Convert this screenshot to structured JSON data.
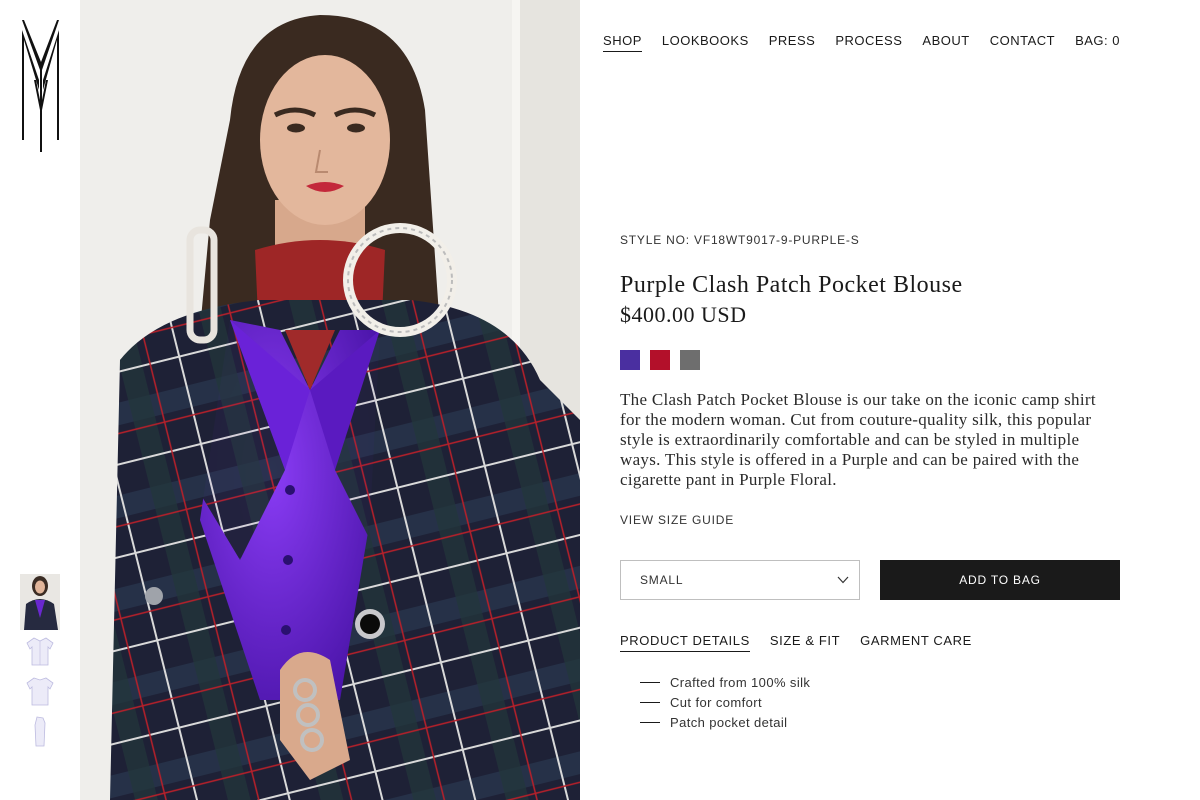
{
  "brand": {
    "logo_icon": "vm-monogram-icon"
  },
  "nav": {
    "items": [
      {
        "label": "SHOP",
        "active": true
      },
      {
        "label": "LOOKBOOKS"
      },
      {
        "label": "PRESS"
      },
      {
        "label": "PROCESS"
      },
      {
        "label": "ABOUT"
      },
      {
        "label": "CONTACT"
      },
      {
        "label": "BAG: 0"
      }
    ]
  },
  "product": {
    "style_no": "STYLE NO: VF18WT9017-9-PURPLE-S",
    "title": "Purple Clash Patch Pocket Blouse",
    "price": "$400.00 USD",
    "swatches": [
      {
        "name": "purple",
        "color": "#4a2fa0"
      },
      {
        "name": "red",
        "color": "#b3102a"
      },
      {
        "name": "silver",
        "color": "#6e6e6e"
      }
    ],
    "description": "The Clash Patch Pocket Blouse is our take on the iconic camp shirt for the modern woman. Cut from couture-quality silk, this popular style is extraordinarily comfortable and can be styled in multiple ways. This style is offered in a Purple and can be paired with the cigarette pant in Purple Floral.",
    "size_guide": "VIEW SIZE GUIDE",
    "size_selected": "SMALL",
    "add_to_bag": "ADD TO BAG"
  },
  "tabs": [
    {
      "label": "PRODUCT DETAILS",
      "active": true
    },
    {
      "label": "SIZE & FIT"
    },
    {
      "label": "GARMENT CARE"
    }
  ],
  "details": [
    "Crafted from 100% silk",
    "Cut for comfort",
    "Patch pocket detail"
  ],
  "thumbnails": [
    "model-look",
    "blouse-front",
    "blouse-back",
    "blouse-side"
  ]
}
